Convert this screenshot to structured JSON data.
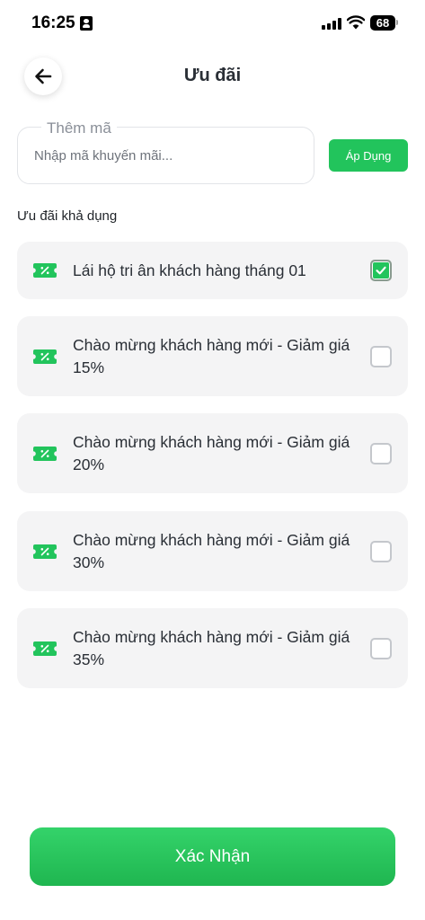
{
  "status_bar": {
    "time": "16:25",
    "battery": "68"
  },
  "header": {
    "title": "Ưu đãi"
  },
  "promo_code": {
    "legend": "Thêm mã",
    "placeholder": "Nhập mã khuyến mãi...",
    "value": "",
    "apply_label": "Áp Dụng"
  },
  "offers": {
    "section_title": "Ưu đãi khả dụng",
    "items": [
      {
        "label": "Lái hộ tri ân khách hàng tháng 01",
        "checked": true
      },
      {
        "label": "Chào mừng khách hàng mới - Giảm giá 15%",
        "checked": false
      },
      {
        "label": "Chào mừng khách hàng mới - Giảm giá 20%",
        "checked": false
      },
      {
        "label": "Chào mừng khách hàng mới - Giảm giá 30%",
        "checked": false
      },
      {
        "label": "Chào mừng khách hàng mới - Giảm giá 35%",
        "checked": false
      }
    ]
  },
  "footer": {
    "confirm_label": "Xác Nhận"
  },
  "icons": {
    "back": "arrow-left-icon",
    "offer": "discount-ticket-icon",
    "check": "checkmark-icon"
  },
  "colors": {
    "accent": "#22c45c",
    "card_background": "#f4f4f5"
  }
}
